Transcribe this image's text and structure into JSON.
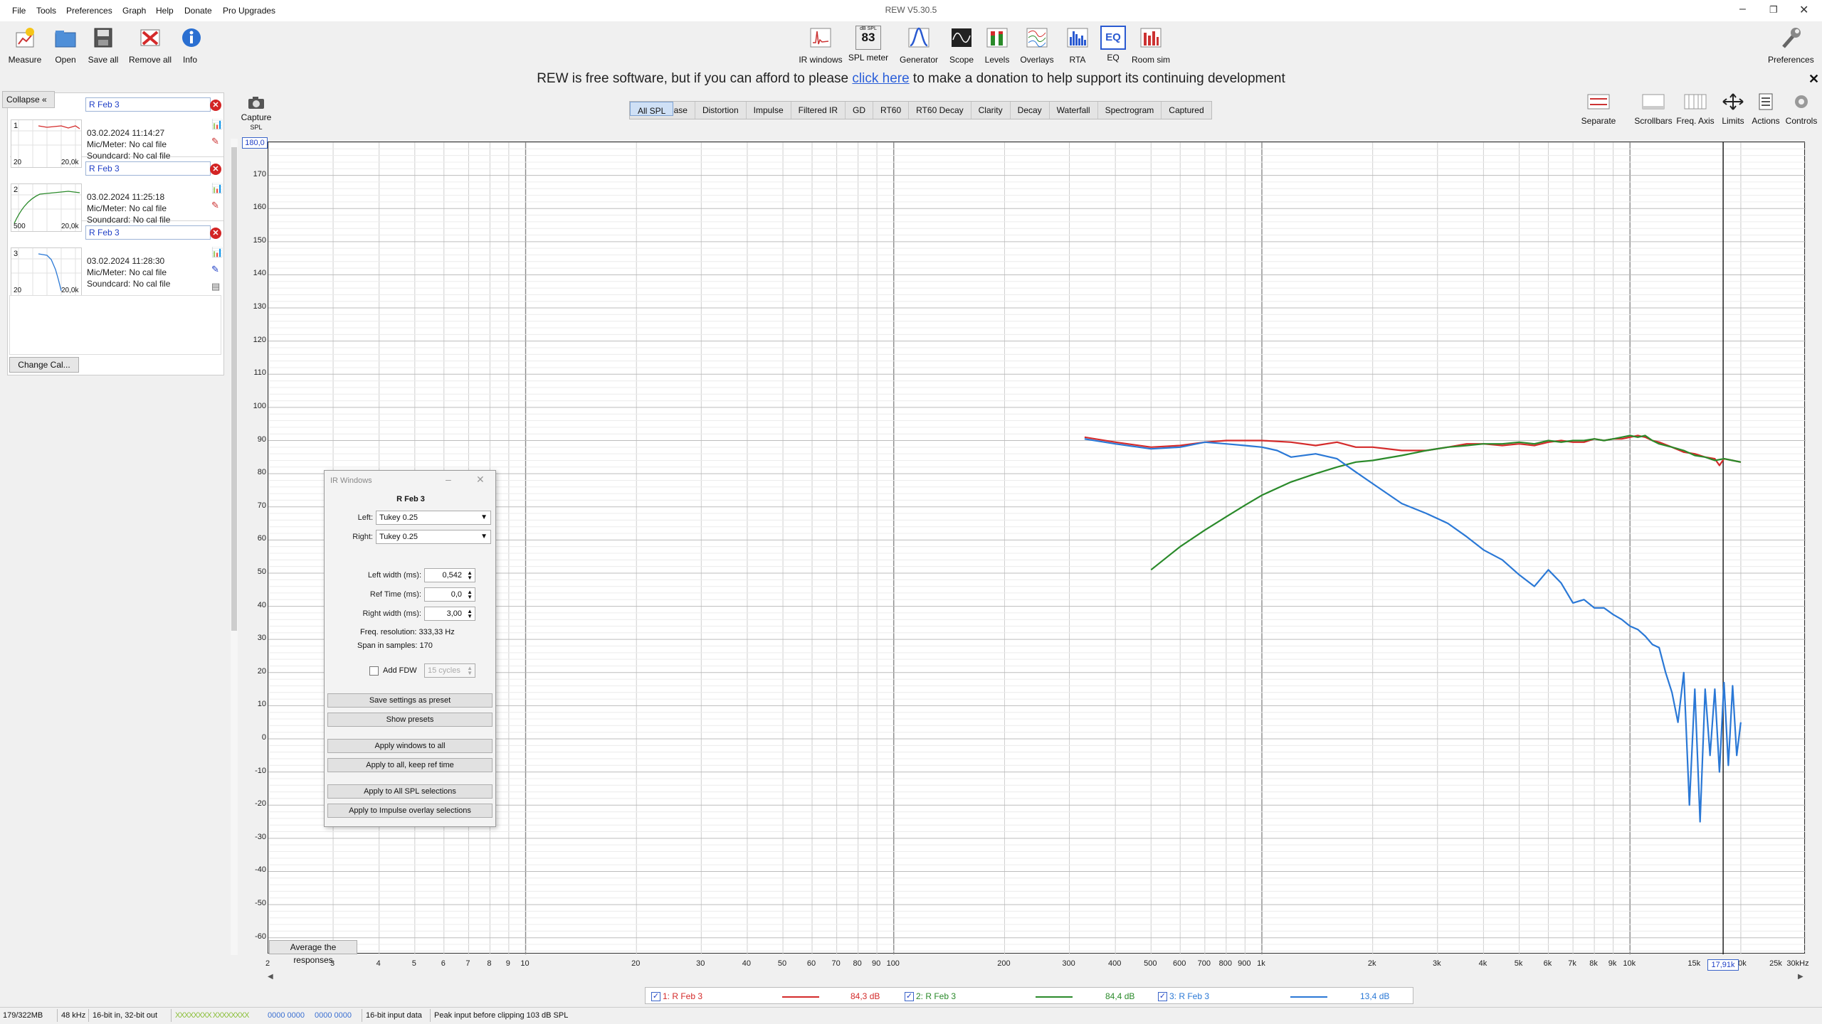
{
  "window": {
    "title": "REW V5.30.5",
    "menu": [
      "File",
      "Tools",
      "Preferences",
      "Graph",
      "Help",
      "Donate",
      "Pro Upgrades"
    ]
  },
  "toolbar_left": [
    {
      "label": "Measure",
      "icon": "measure-icon"
    },
    {
      "label": "Open",
      "icon": "folder-open-icon"
    },
    {
      "label": "Save all",
      "icon": "save-icon"
    },
    {
      "label": "Remove all",
      "icon": "remove-all-icon"
    },
    {
      "label": "Info",
      "icon": "info-icon"
    }
  ],
  "toolbar_center": [
    {
      "label": "IR windows",
      "icon": "ir-windows-icon"
    },
    {
      "label": "SPL meter",
      "icon": "spl-meter-icon",
      "badge_top": "dB SPL",
      "badge": "83"
    },
    {
      "label": "Generator",
      "icon": "generator-icon"
    },
    {
      "label": "Scope",
      "icon": "scope-icon"
    },
    {
      "label": "Levels",
      "icon": "levels-icon"
    },
    {
      "label": "Overlays",
      "icon": "overlays-icon"
    },
    {
      "label": "RTA",
      "icon": "rta-icon"
    },
    {
      "label": "EQ",
      "icon": "eq-icon",
      "badge": "EQ"
    },
    {
      "label": "Room sim",
      "icon": "room-sim-icon"
    }
  ],
  "toolbar_right": {
    "label": "Preferences",
    "icon": "wrench-icon"
  },
  "donate": {
    "before": "REW is free software, but if you can afford to please ",
    "link": "click here",
    "after": " to make a donation to help support its continuing development"
  },
  "left_panel": {
    "collapse_label": "Collapse",
    "change_cal_label": "Change Cal...",
    "measurements": [
      {
        "index": "1",
        "name": "R Feb 3",
        "date": "03.02.2024 11:14:27",
        "mic": "Mic/Meter: No cal file",
        "soundcard": "Soundcard: No cal file",
        "thumb_x0": "20",
        "thumb_x1": "20,0k",
        "color": "#d42a2a"
      },
      {
        "index": "2",
        "name": "R Feb 3",
        "date": "03.02.2024 11:25:18",
        "mic": "Mic/Meter: No cal file",
        "soundcard": "Soundcard: No cal file",
        "thumb_x0": "500",
        "thumb_x1": "20,0k",
        "color": "#2a8a2a"
      },
      {
        "index": "3",
        "name": "R Feb 3",
        "date": "03.02.2024 11:28:30",
        "mic": "Mic/Meter: No cal file",
        "soundcard": "Soundcard: No cal file",
        "thumb_x0": "20",
        "thumb_x1": "20,0k",
        "color": "#2a78d6"
      }
    ]
  },
  "capture": {
    "label": "Capture",
    "sub": "SPL"
  },
  "tabs": [
    "SPL & Phase",
    "All SPL",
    "Distortion",
    "Impulse",
    "Filtered IR",
    "GD",
    "RT60",
    "RT60 Decay",
    "Clarity",
    "Decay",
    "Waterfall",
    "Spectrogram",
    "Captured"
  ],
  "selected_tab": "All SPL",
  "right_tools": [
    {
      "label": "Separate",
      "icon": "separate-icon"
    },
    {
      "label": "Scrollbars",
      "icon": "scrollbars-icon"
    },
    {
      "label": "Freq. Axis",
      "icon": "freq-axis-icon"
    },
    {
      "label": "Limits",
      "icon": "limits-icon"
    },
    {
      "label": "Actions",
      "icon": "actions-icon"
    },
    {
      "label": "Controls",
      "icon": "controls-icon"
    }
  ],
  "graph": {
    "y_top_value": "180,0",
    "y_ticks": [
      "170",
      "160",
      "150",
      "140",
      "130",
      "120",
      "110",
      "100",
      "90",
      "80",
      "70",
      "60",
      "50",
      "40",
      "30",
      "20",
      "10",
      "0",
      "-10",
      "-20",
      "-30",
      "-40",
      "-50",
      "-60"
    ],
    "x_ticks": [
      "2",
      "3",
      "4",
      "5",
      "6",
      "7",
      "8",
      "9",
      "10",
      "20",
      "30",
      "40",
      "50",
      "60",
      "70",
      "80",
      "90",
      "100",
      "200",
      "300",
      "400",
      "500",
      "600",
      "700",
      "800",
      "900",
      "1k",
      "2k",
      "3k",
      "4k",
      "5k",
      "6k",
      "7k",
      "8k",
      "9k",
      "10k",
      "15k",
      "20k",
      "25k",
      "30kHz"
    ],
    "x_tick_values": [
      2,
      3,
      4,
      5,
      6,
      7,
      8,
      9,
      10,
      20,
      30,
      40,
      50,
      60,
      70,
      80,
      90,
      100,
      200,
      300,
      400,
      500,
      600,
      700,
      800,
      900,
      1000,
      2000,
      3000,
      4000,
      5000,
      6000,
      7000,
      8000,
      9000,
      10000,
      15000,
      20000,
      25000,
      30000
    ],
    "cursor_freq": "17,91k",
    "average_label": "Average the responses"
  },
  "chart_data": {
    "type": "line",
    "title": "",
    "xlabel": "",
    "ylabel": "",
    "x_scale": "log",
    "xlim": [
      2,
      30000
    ],
    "ylim": [
      -65,
      180
    ],
    "x_unit": "Hz",
    "y_unit": "dB",
    "cursor_x": 17910,
    "series": [
      {
        "name": "1: R Feb 3",
        "color": "#d42a2a",
        "x": [
          330,
          400,
          500,
          600,
          700,
          800,
          900,
          1000,
          1200,
          1400,
          1600,
          1800,
          2000,
          2400,
          2800,
          3200,
          3600,
          4000,
          4500,
          5000,
          5500,
          6000,
          6500,
          7000,
          7500,
          8000,
          8500,
          9000,
          9500,
          10000,
          10500,
          11000,
          11500,
          12000,
          13000,
          14000,
          15000,
          16000,
          17000,
          17500,
          18000,
          19000,
          20000
        ],
        "y": [
          91,
          89.5,
          88,
          88.5,
          89.5,
          90,
          90,
          90,
          89.5,
          88.5,
          89.5,
          88,
          88,
          87,
          87,
          88,
          89,
          89,
          88.5,
          89,
          88.5,
          89.5,
          90,
          89.5,
          89.5,
          90.5,
          90,
          90.5,
          90.5,
          91,
          91.5,
          91,
          90,
          89.5,
          88,
          86.5,
          86,
          85,
          84.5,
          82.5,
          84.5,
          84,
          83.5
        ]
      },
      {
        "name": "2: R Feb 3",
        "color": "#2a8a2a",
        "x": [
          500,
          600,
          700,
          800,
          900,
          1000,
          1200,
          1400,
          1600,
          1800,
          2000,
          2400,
          2800,
          3200,
          3600,
          4000,
          4500,
          5000,
          5500,
          6000,
          6500,
          7000,
          7500,
          8000,
          8500,
          9000,
          9500,
          10000,
          10500,
          11000,
          11500,
          12000,
          13000,
          14000,
          15000,
          16000,
          17000,
          18000,
          19000,
          20000
        ],
        "y": [
          51,
          58,
          63,
          67,
          70.5,
          73.5,
          77.5,
          80,
          82,
          83.5,
          84,
          85.5,
          87,
          88,
          88.5,
          89,
          89,
          89.5,
          89,
          90,
          89.5,
          90,
          90,
          90.5,
          90,
          90.5,
          91,
          91.5,
          91,
          91.5,
          90,
          89,
          88,
          87,
          85.5,
          85,
          84,
          84.5,
          84,
          83.5
        ]
      },
      {
        "name": "3: R Feb 3",
        "color": "#2a78d6",
        "x": [
          330,
          400,
          500,
          600,
          700,
          800,
          900,
          1000,
          1100,
          1200,
          1400,
          1600,
          1800,
          2000,
          2400,
          2800,
          3200,
          3600,
          4000,
          4500,
          5000,
          5500,
          6000,
          6500,
          7000,
          7500,
          8000,
          8500,
          9000,
          9500,
          10000,
          10500,
          11000,
          11500,
          12000,
          12500,
          13000,
          13500,
          14000,
          14500,
          15000,
          15500,
          16000,
          16500,
          17000,
          17500,
          18000,
          18500,
          19000,
          19500,
          20000
        ],
        "y": [
          90.5,
          89,
          87.5,
          88,
          89.5,
          89,
          88.5,
          88,
          87,
          85,
          86,
          84.5,
          80.5,
          77,
          71,
          68,
          65,
          61,
          57,
          54,
          49.5,
          46,
          51,
          47,
          41,
          42,
          39.5,
          39.5,
          37.5,
          36,
          34,
          33,
          31,
          28.5,
          27.5,
          20,
          14,
          5,
          20,
          -20,
          15,
          -25,
          15,
          -5,
          15,
          -10,
          17,
          -8,
          16,
          -5,
          5
        ]
      }
    ]
  },
  "legend": [
    {
      "label": "1: R Feb 3",
      "value": "84,3 dB",
      "color": "#d42a2a",
      "checked": "✓"
    },
    {
      "label": "2: R Feb 3",
      "value": "84,4 dB",
      "color": "#2a8a2a",
      "checked": "✓"
    },
    {
      "label": "3: R Feb 3",
      "value": "13,4 dB",
      "color": "#2a78d6",
      "checked": "✓"
    }
  ],
  "status": {
    "memory": "179/322MB",
    "rate": "48 kHz",
    "bits": "16-bit in, 32-bit out",
    "levels_a": "0000 0000",
    "levels_b": "0000 0000",
    "input_data": "16-bit input data",
    "peak": "Peak input before clipping 103 dB SPL"
  },
  "ir_dialog": {
    "title": "IR Windows",
    "measurement": "R Feb 3",
    "left_label": "Left:",
    "left_value": "Tukey 0.25",
    "right_label": "Right:",
    "right_value": "Tukey 0.25",
    "left_width_label": "Left width (ms):",
    "left_width": "0,542",
    "ref_time_label": "Ref Time (ms):",
    "ref_time": "0,0",
    "right_width_label": "Right width (ms):",
    "right_width": "3,00",
    "freq_res_label": "Freq. resolution:",
    "freq_res": "333,33 Hz",
    "span_label": "Span in samples:",
    "span": "170",
    "add_fdw_label": "Add FDW",
    "fdw_value": "15 cycles",
    "buttons": [
      "Save settings as preset",
      "Show presets",
      "Apply windows to all",
      "Apply to all, keep ref time",
      "Apply to All SPL selections",
      "Apply to Impulse overlay selections"
    ]
  }
}
